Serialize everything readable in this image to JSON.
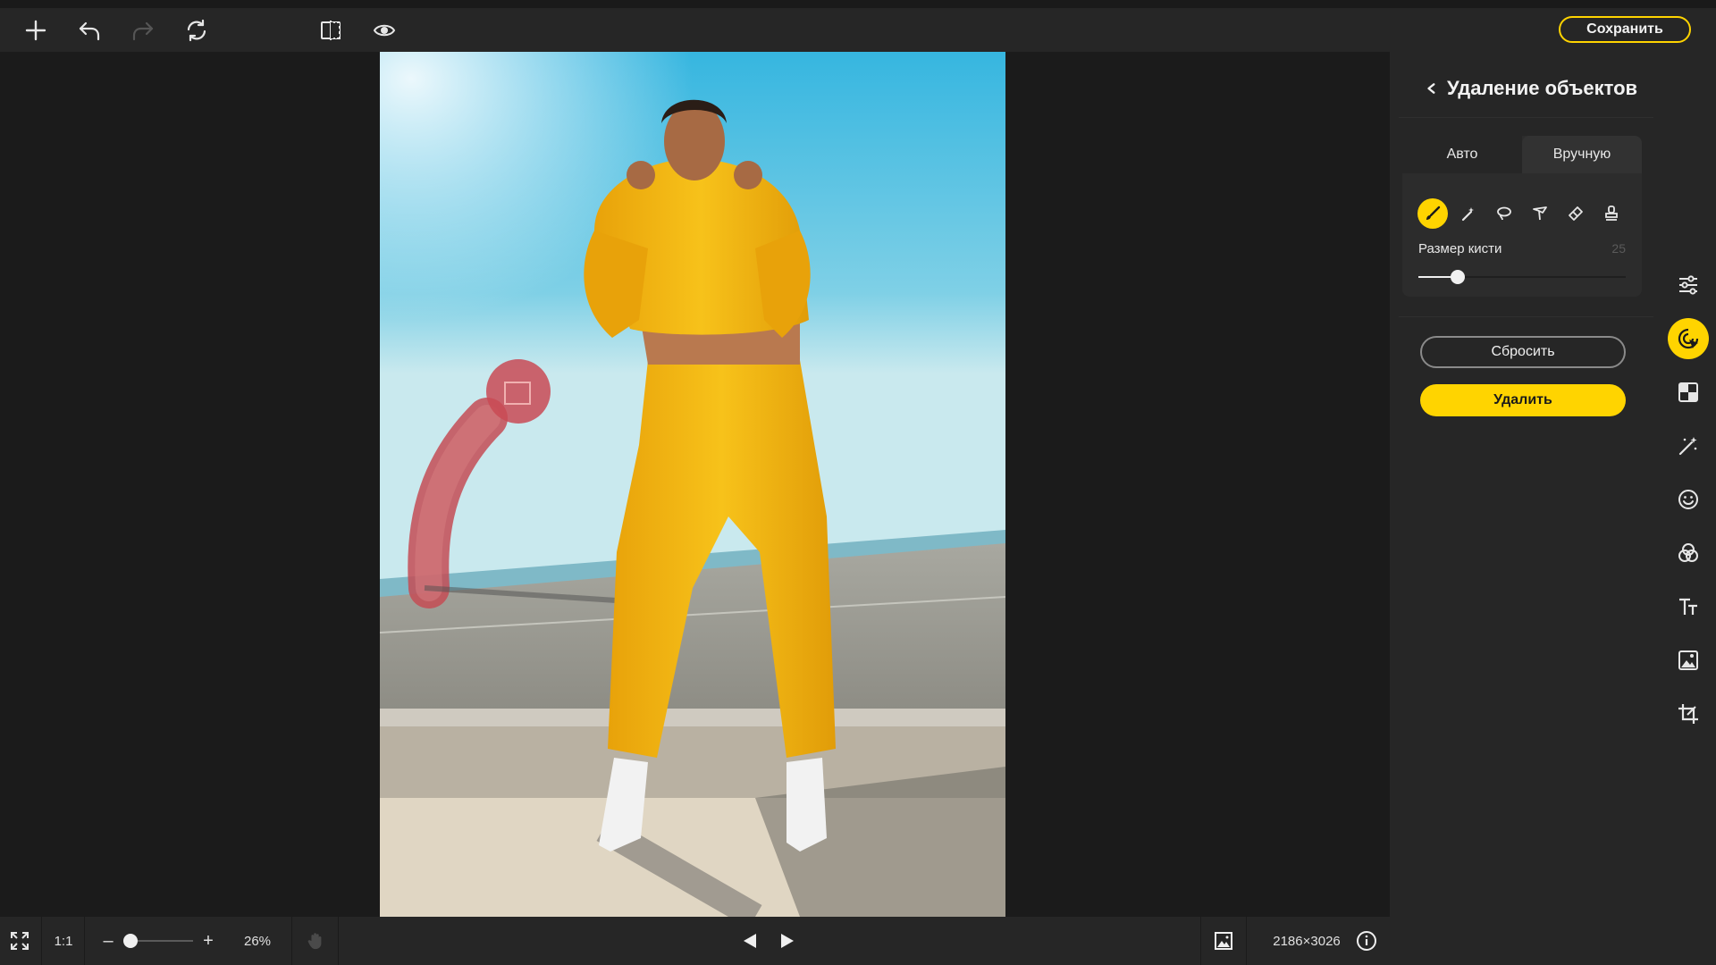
{
  "toolbar": {
    "save_label": "Сохранить",
    "icons": [
      "add-icon",
      "undo-icon",
      "redo-icon",
      "reset-icon",
      "compare-icon",
      "preview-icon"
    ]
  },
  "panel": {
    "title": "Удаление объектов",
    "tabs": [
      {
        "label": "Авто",
        "active": false
      },
      {
        "label": "Вручную",
        "active": true
      }
    ],
    "tools": [
      "brush-icon",
      "magic-wand-icon",
      "lasso-icon",
      "polygon-lasso-icon",
      "eraser-icon",
      "stamp-icon"
    ],
    "brush_size_label": "Размер кисти",
    "brush_size_value": "25",
    "brush_size_fraction": 0.19,
    "reset_label": "Сбросить",
    "delete_label": "Удалить"
  },
  "rail": {
    "icons": [
      "adjust-sliders-icon",
      "object-removal-icon",
      "background-icon",
      "magic-retouch-icon",
      "face-icon",
      "color-filters-icon",
      "text-icon",
      "image-icon",
      "crop-icon"
    ],
    "active": "object-removal-icon"
  },
  "bottombar": {
    "fit_icon": "fullscreen-icon",
    "ratio_label": "1:1",
    "zoom_minus": "–",
    "zoom_plus": "+",
    "zoom_value": "26%",
    "image_size": "2186×3026",
    "accent": "#ffd400"
  }
}
